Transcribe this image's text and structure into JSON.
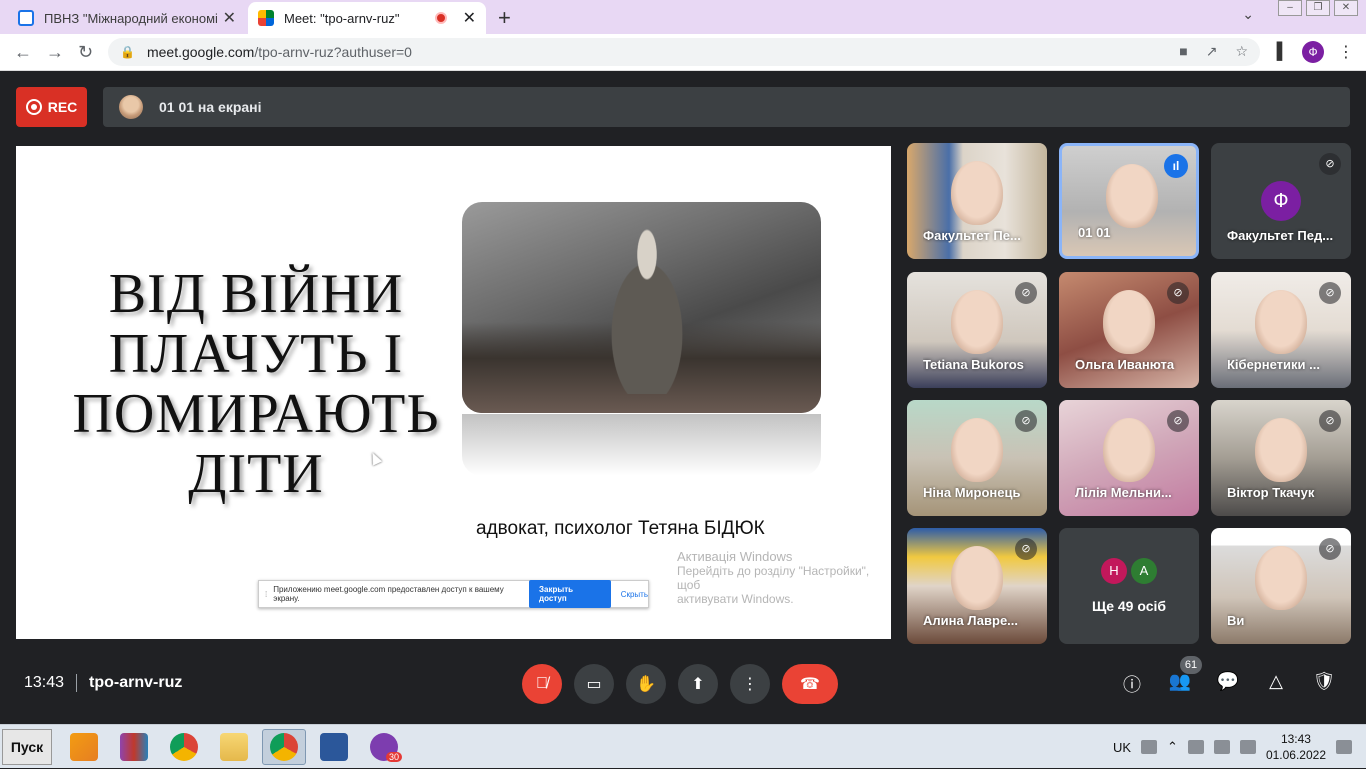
{
  "browser": {
    "tabs": [
      {
        "title": "ПВНЗ \"Міжнародний економіко-",
        "close": "✕"
      },
      {
        "title": "Meet: \"tpo-arnv-ruz\"",
        "close": "✕"
      }
    ],
    "new_tab": "+",
    "url_host": "meet.google.com",
    "url_path": "/tpo-arnv-ruz?authuser=0",
    "profile_initial": "Ф"
  },
  "meet": {
    "rec_label": "REC",
    "presenter_banner": "01 01 на екрані",
    "slide": {
      "title": "ВІД ВІЙНИ ПЛАЧУТЬ І ПОМИРАЮТЬ ДІТИ",
      "caption": "адвокат, психолог Тетяна БІДЮК"
    },
    "activation": {
      "line1": "Активація Windows",
      "line2": "Перейдіть до розділу \"Настройки\", щоб",
      "line3": "активувати Windows."
    },
    "share_notice": {
      "text": "Приложению meet.google.com предоставлен доступ к вашему экрану.",
      "stop": "Закрыть доступ",
      "hide": "Скрыть"
    },
    "participants": [
      {
        "name": "Факультет Пе..."
      },
      {
        "name": "01 01"
      },
      {
        "name": "Факультет Пед...",
        "initial": "Ф"
      },
      {
        "name": "Tetiana Bukoros"
      },
      {
        "name": "Ольга Иванюта"
      },
      {
        "name": "Кібернетики ..."
      },
      {
        "name": "Ніна Миронець"
      },
      {
        "name": "Лілія Мельни..."
      },
      {
        "name": "Віктор Ткачук"
      },
      {
        "name": "Алина Лавре..."
      },
      {
        "name": "Ще 49 осіб",
        "avatars": [
          "Н",
          "А"
        ]
      },
      {
        "name": "Ви"
      }
    ],
    "time": "13:43",
    "meeting_code": "tpo-arnv-ruz",
    "participants_count": "61"
  },
  "taskbar": {
    "start": "Пуск",
    "lang": "UK",
    "clock_time": "13:43",
    "clock_date": "01.06.2022",
    "viber_badge": "30"
  },
  "colors": {
    "meet_bg": "#202124",
    "red": "#ea4335",
    "tab_bar": "#e8d8f4",
    "accent_blue": "#1a73e8"
  }
}
